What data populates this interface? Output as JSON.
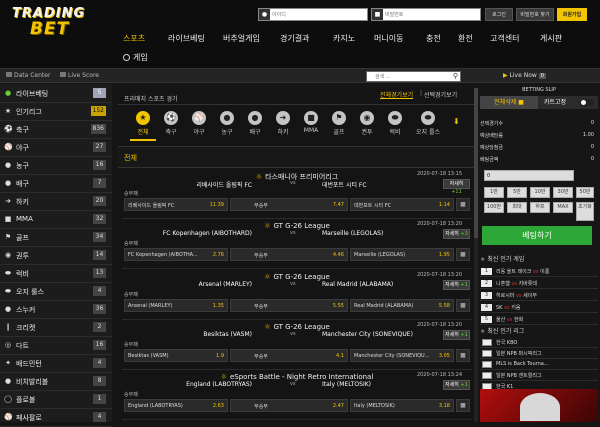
{
  "logo": {
    "line1": "TRADING",
    "line2": "BET"
  },
  "header": {
    "id_placeholder": "아이디",
    "pw_placeholder": "비밀번호",
    "login_label": "로그인",
    "find_pw_label": "비밀번호 찾기",
    "join_label": "회원가입"
  },
  "nav": {
    "items": [
      "스포츠",
      "라이브베팅",
      "버추얼게임",
      "경기결과",
      "카지노",
      "머니이동",
      "충전",
      "환전",
      "고객센터",
      "게시판"
    ],
    "second_row": "게임"
  },
  "subbar": {
    "data_center": "Data Center",
    "live_score": "Live Score",
    "search_placeholder": "검색 ...",
    "live_now_label": "Live Now",
    "live_now_count": "0"
  },
  "sidebar": {
    "items": [
      {
        "label": "라이브베팅",
        "count": "5",
        "icon": "live-dot-icon"
      },
      {
        "label": "인기리그",
        "count": "152",
        "icon": "trophy-icon"
      },
      {
        "label": "축구",
        "count": "836",
        "icon": "soccer-icon"
      },
      {
        "label": "야구",
        "count": "27",
        "icon": "baseball-icon"
      },
      {
        "label": "농구",
        "count": "16",
        "icon": "basketball-icon"
      },
      {
        "label": "배구",
        "count": "7",
        "icon": "volleyball-icon"
      },
      {
        "label": "하키",
        "count": "20",
        "icon": "hockey-icon"
      },
      {
        "label": "MMA",
        "count": "32",
        "icon": "mma-icon"
      },
      {
        "label": "골프",
        "count": "34",
        "icon": "golf-icon"
      },
      {
        "label": "권투",
        "count": "14",
        "icon": "boxing-icon"
      },
      {
        "label": "럭비",
        "count": "13",
        "icon": "rugby-icon"
      },
      {
        "label": "오지 룰스",
        "count": "4",
        "icon": "aussie-rules-icon"
      },
      {
        "label": "스누커",
        "count": "36",
        "icon": "snooker-icon"
      },
      {
        "label": "크리켓",
        "count": "2",
        "icon": "cricket-icon"
      },
      {
        "label": "다트",
        "count": "16",
        "icon": "darts-icon"
      },
      {
        "label": "배드민턴",
        "count": "4",
        "icon": "badminton-icon"
      },
      {
        "label": "비치발리볼",
        "count": "8",
        "icon": "beach-volleyball-icon"
      },
      {
        "label": "플로볼",
        "count": "1",
        "icon": "floorball-icon"
      },
      {
        "label": "페사팔로",
        "count": "4",
        "icon": "pesapallo-icon"
      }
    ]
  },
  "main": {
    "breadcrumb": "프리매치 스포츠 경기",
    "tab_prematch": "전체경기보기",
    "tab_popular": "선택경기보기",
    "sports": [
      {
        "label": "전체",
        "icon": "all-icon"
      },
      {
        "label": "축구",
        "icon": "soccer-icon"
      },
      {
        "label": "야구",
        "icon": "baseball-icon"
      },
      {
        "label": "농구",
        "icon": "basketball-icon"
      },
      {
        "label": "배구",
        "icon": "volleyball-icon"
      },
      {
        "label": "하키",
        "icon": "hockey-icon"
      },
      {
        "label": "MMA",
        "icon": "mma-icon"
      },
      {
        "label": "골프",
        "icon": "golf-icon"
      },
      {
        "label": "권투",
        "icon": "boxing-icon"
      },
      {
        "label": "럭비",
        "icon": "rugby-icon"
      },
      {
        "label": "오지 룰스",
        "icon": "aussie-rules-icon"
      }
    ],
    "section_title": "전체",
    "matches": [
      {
        "league": "타스매니아 프리미어리그",
        "time": "2020-07-18 13:15",
        "home": "리베사이드 올림픽 FC",
        "away": "데번포트 시티 FC",
        "more": "자세히",
        "more_count": "+11",
        "market": "승무패",
        "home_odds_name": "리베사이드 올림픽 FC",
        "home_odds": "11.39",
        "draw_name": "무승부",
        "draw_odds": "7.47",
        "away_odds_name": "데번포트 시티 FC",
        "away_odds": "1.14"
      },
      {
        "league": "GT G-26 League",
        "time": "2020-07-18 13:20",
        "home": "FC Kopenhagen (AIBOTHARD)",
        "away": "Marseille (LEGOLAS)",
        "more": "자세히",
        "more_count": "+3",
        "market": "승무패",
        "home_odds_name": "FC Kopenhagen (AIBOTHA...",
        "home_odds": "2.76",
        "draw_name": "무승부",
        "draw_odds": "4.46",
        "away_odds_name": "Marseille (LEGOLAS)",
        "away_odds": "1.95"
      },
      {
        "league": "GT G-26 League",
        "time": "2020-07-18 13:20",
        "home": "Arsenal (MARLEY)",
        "away": "Real Madrid (ALABAMA)",
        "more": "자세히",
        "more_count": "+1",
        "market": "승무패",
        "home_odds_name": "Arsenal (MARLEY)",
        "home_odds": "1.35",
        "draw_name": "무승부",
        "draw_odds": "5.55",
        "away_odds_name": "Real Madrid (ALABAMA)",
        "away_odds": "5.58"
      },
      {
        "league": "GT G-26 League",
        "time": "2020-07-18 13:20",
        "home": "Besiktas (VASM)",
        "away": "Manchester City (SONEVIQUE)",
        "more": "자세히",
        "more_count": "+1",
        "market": "승무패",
        "home_odds_name": "Besiktas (VASM)",
        "home_odds": "1.9",
        "draw_name": "무승부",
        "draw_odds": "4.1",
        "away_odds_name": "Manchester City (SONEVIQU...",
        "away_odds": "3.05"
      },
      {
        "league": "eSports Battle - Night Retro International",
        "time": "2020-07-18 13:24",
        "home": "England (LABOTRYAS)",
        "away": "Italy (MELTOSIK)",
        "more": "자세히",
        "more_count": "+1",
        "market": "승무패",
        "home_odds_name": "England (LABOTRYAS)",
        "home_odds": "2.63",
        "draw_name": "무승부",
        "draw_odds": "2.47",
        "away_odds_name": "Italy (MELTOSIK)",
        "away_odds": "3.18"
      }
    ]
  },
  "betslip": {
    "title": "BETTING SLIP",
    "clear_label": "전체삭제",
    "cart_label": "카트고정",
    "rows": [
      {
        "k": "선택경기수",
        "v": "0"
      },
      {
        "k": "예상배당률",
        "v": "1.00"
      },
      {
        "k": "예상당첨금",
        "v": "0"
      },
      {
        "k": "베팅금액",
        "v": "0"
      }
    ],
    "stake_value": "0",
    "quick_row1": [
      "1만",
      "5만",
      "10만",
      "30만",
      "50만"
    ],
    "quick_row2": [
      "100만",
      "최대",
      "하프",
      "MAX",
      "초기화"
    ],
    "bet_button": "베팅하기",
    "hot_title": "최신 인기 게임",
    "hot_games": [
      {
        "num": "1",
        "a": "리옹 올트 레이크",
        "b": "이롬"
      },
      {
        "num": "2",
        "a": "니혼햄",
        "b": "지바롯데"
      },
      {
        "num": "3",
        "a": "히로시마",
        "b": "세이부"
      },
      {
        "num": "4",
        "a": "SK",
        "b": "키움"
      },
      {
        "num": "5",
        "a": "울산",
        "b": "한화"
      }
    ],
    "league_title": "최신 인기 리그",
    "leagues": [
      "한국 KBO",
      "일본 NPB 퍼시픽리그",
      "MLS is Back Tourna...",
      "일본 NPB 센트럴리그",
      "한국 K1"
    ]
  }
}
